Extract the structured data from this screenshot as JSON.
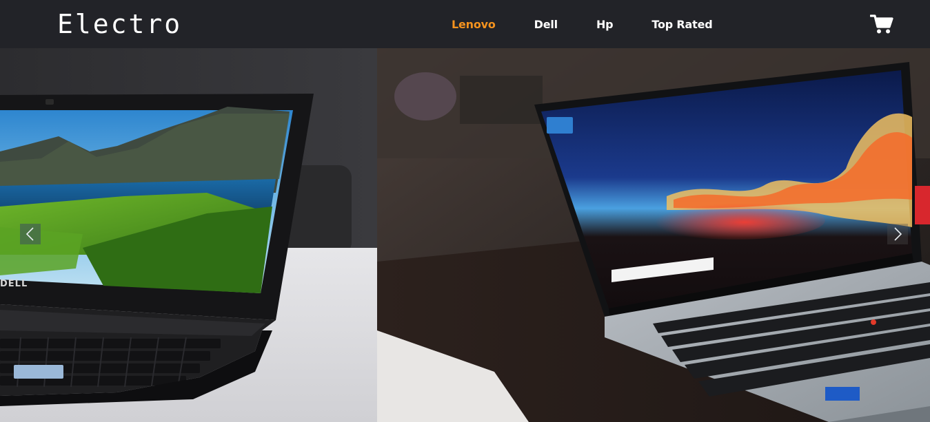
{
  "brand": {
    "name": "Electro"
  },
  "nav": {
    "links": [
      {
        "label": "Lenovo",
        "active": true
      },
      {
        "label": "Dell",
        "active": false
      },
      {
        "label": "Hp",
        "active": false
      },
      {
        "label": "Top Rated",
        "active": false
      }
    ]
  },
  "icons": {
    "cart": "shopping-cart-icon",
    "prev": "chevron-left-icon",
    "next": "chevron-right-icon"
  },
  "carousel": {
    "slides": [
      {
        "name": "dell-laptop-photo"
      },
      {
        "name": "lenovo-laptop-photo"
      }
    ],
    "laptop_logo_text": "DELL"
  },
  "colors": {
    "navbar": "#222328",
    "accent": "#f5931e",
    "text": "#ffffff"
  }
}
